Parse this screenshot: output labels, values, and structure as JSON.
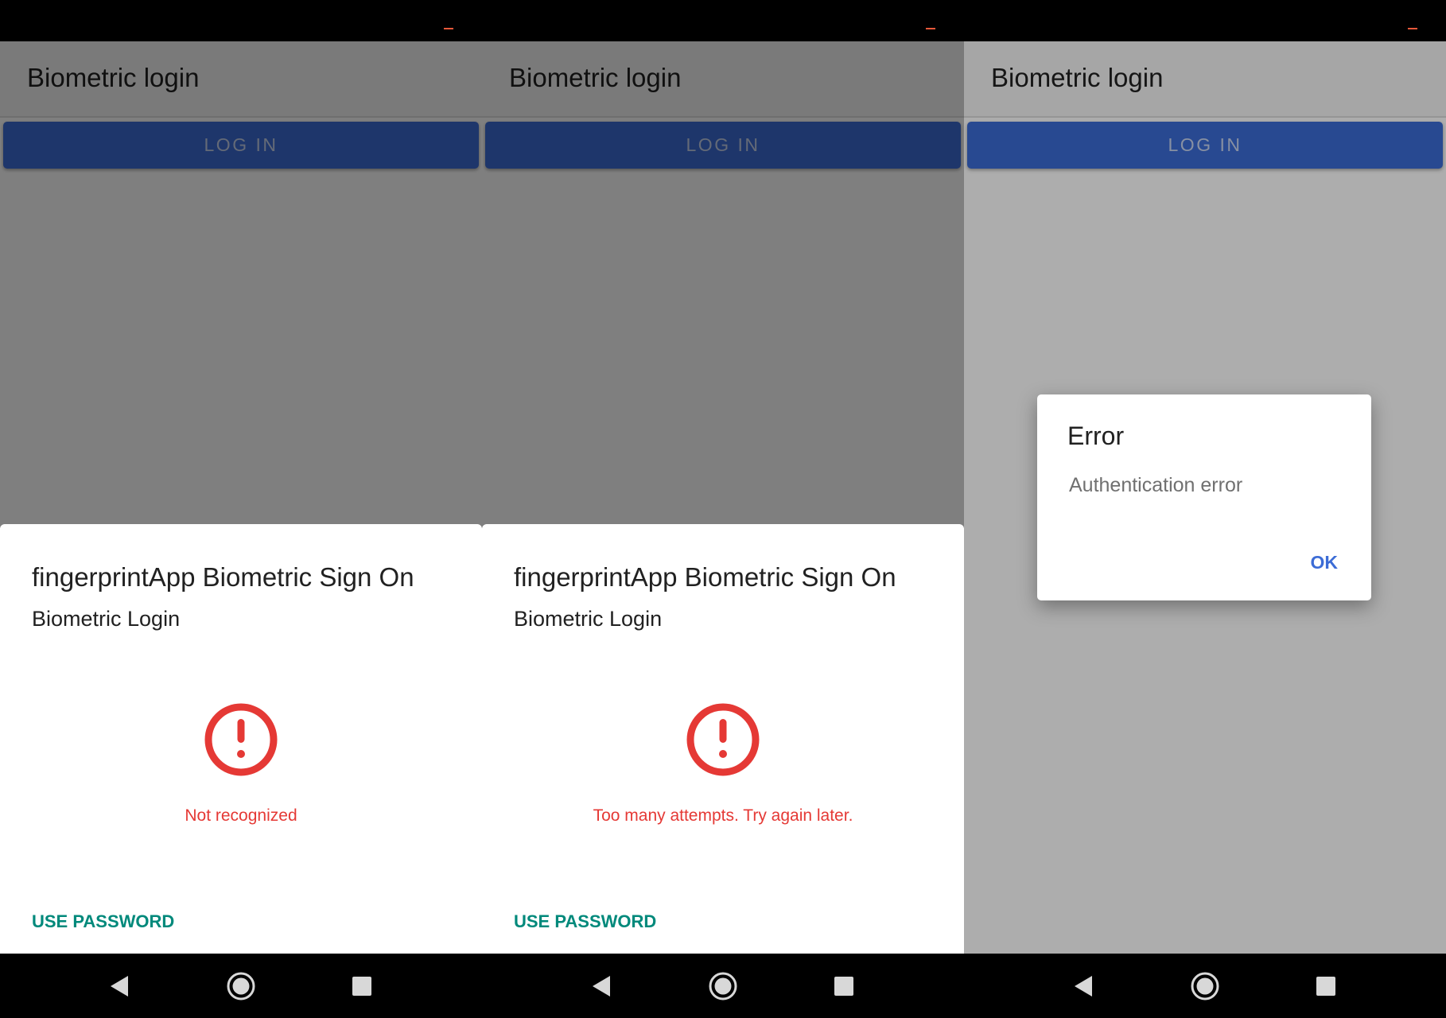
{
  "screens": [
    {
      "app_title": "Biometric login",
      "login_label": "LOG IN",
      "prompt": {
        "title": "fingerprintApp Biometric Sign On",
        "subtitle": "Biometric Login",
        "icon": "error-circle-icon",
        "message": "Not recognized",
        "negative_button": "USE PASSWORD"
      }
    },
    {
      "app_title": "Biometric login",
      "login_label": "LOG IN",
      "prompt": {
        "title": "fingerprintApp Biometric Sign On",
        "subtitle": "Biometric Login",
        "icon": "error-circle-icon",
        "message": "Too many attempts. Try again later.",
        "negative_button": "USE PASSWORD"
      }
    },
    {
      "app_title": "Biometric login",
      "login_label": "LOG IN",
      "dialog": {
        "title": "Error",
        "message": "Authentication error",
        "ok_label": "OK"
      }
    }
  ],
  "nav_icons": [
    "back-icon",
    "home-icon",
    "recents-icon"
  ],
  "colors": {
    "primary": "#3c6cd6",
    "error": "#e53935",
    "accent_teal": "#00897b"
  }
}
